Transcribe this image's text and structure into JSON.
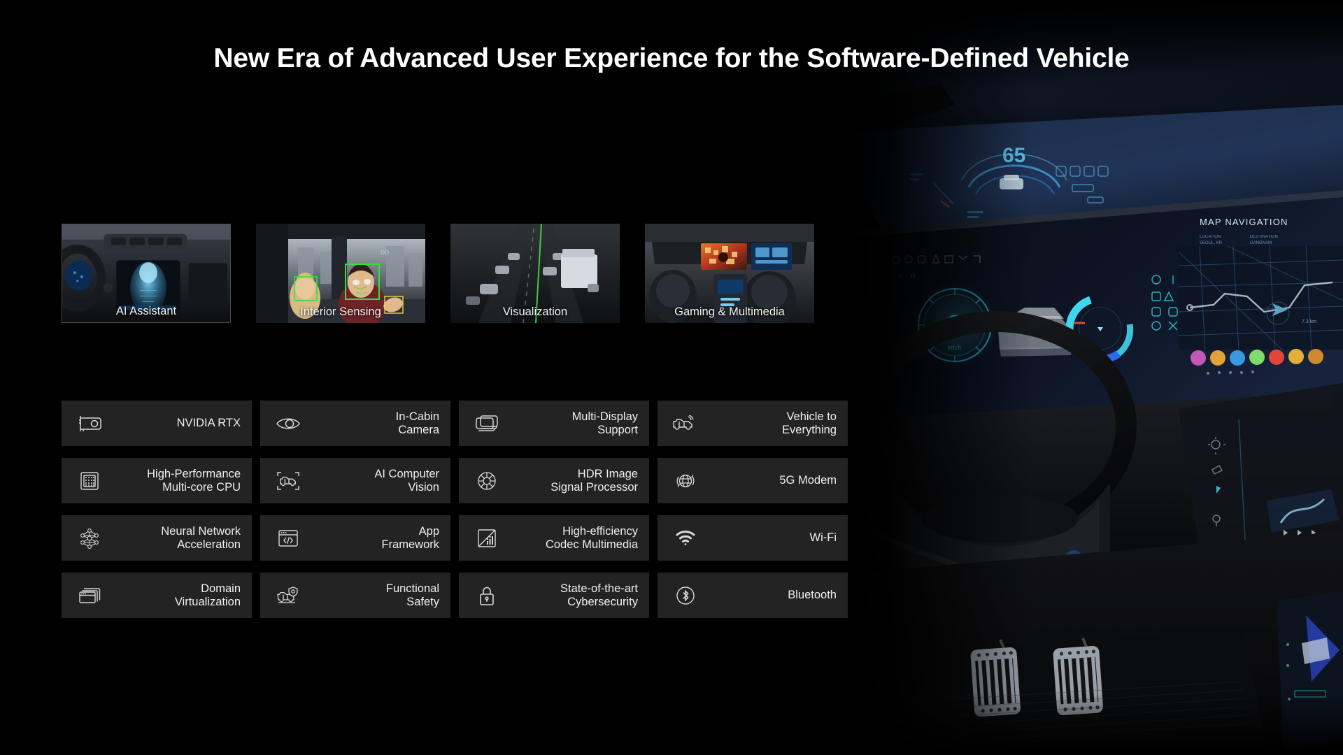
{
  "slide": {
    "title": "New Era of Advanced User Experience for the Software-Defined Vehicle",
    "background_color": "#000000",
    "tile_color": "#232323",
    "text_color": "#efefef"
  },
  "scenarios": [
    {
      "label": "AI Assistant",
      "icon": "cockpit-avatar-photo"
    },
    {
      "label": "Interior Sensing",
      "icon": "driver-monitoring-photo"
    },
    {
      "label": "Visualization",
      "icon": "traffic-visualization-photo"
    },
    {
      "label": "Gaming & Multimedia",
      "icon": "gaming-cabin-photo"
    }
  ],
  "features": [
    {
      "label": "NVIDIA RTX",
      "icon": "gpu-card-icon"
    },
    {
      "label": "In-Cabin\nCamera",
      "icon": "eye-icon"
    },
    {
      "label": "Multi-Display\nSupport",
      "icon": "stacked-screens-icon"
    },
    {
      "label": "Vehicle to\nEverything",
      "icon": "car-signal-icon"
    },
    {
      "label": "High-Performance\nMulti-core CPU",
      "icon": "cpu-chip-icon"
    },
    {
      "label": "AI Computer\nVision",
      "icon": "car-detection-frame-icon"
    },
    {
      "label": "HDR Image\nSignal Processor",
      "icon": "camera-aperture-icon"
    },
    {
      "label": "5G Modem",
      "icon": "globe-network-icon"
    },
    {
      "label": "Neural Network\nAcceleration",
      "icon": "neural-network-icon"
    },
    {
      "label": "App\nFramework",
      "icon": "code-window-icon"
    },
    {
      "label": "High-efficiency\nCodec Multimedia",
      "icon": "codec-signal-icon"
    },
    {
      "label": "Wi-Fi",
      "icon": "wifi-icon"
    },
    {
      "label": "Domain\nVirtualization",
      "icon": "stacked-windows-icon"
    },
    {
      "label": "Functional\nSafety",
      "icon": "car-shield-icon"
    },
    {
      "label": "State-of-the-art\nCybersecurity",
      "icon": "padlock-icon"
    },
    {
      "label": "Bluetooth",
      "icon": "bluetooth-icon"
    }
  ],
  "cockpit": {
    "hud_speed": "65",
    "cluster_speed": "0",
    "cluster_speed_unit": "km/h",
    "map_panel_title": "MAP NAVIGATION",
    "map_panel_field_1": "LOCATION",
    "map_panel_field_2": "DESTINATION",
    "map_distance": "7.3 km",
    "accent_cyan": "#3fd6f0",
    "accent_blue": "#2a6cf0",
    "accent_green": "#4ed94e",
    "screen_tint": "#1b2740",
    "app_dock_colors": [
      "#c257b8",
      "#e0a23a",
      "#3a9ae0",
      "#7ddc6a",
      "#e0453a",
      "#e0b03a"
    ]
  }
}
